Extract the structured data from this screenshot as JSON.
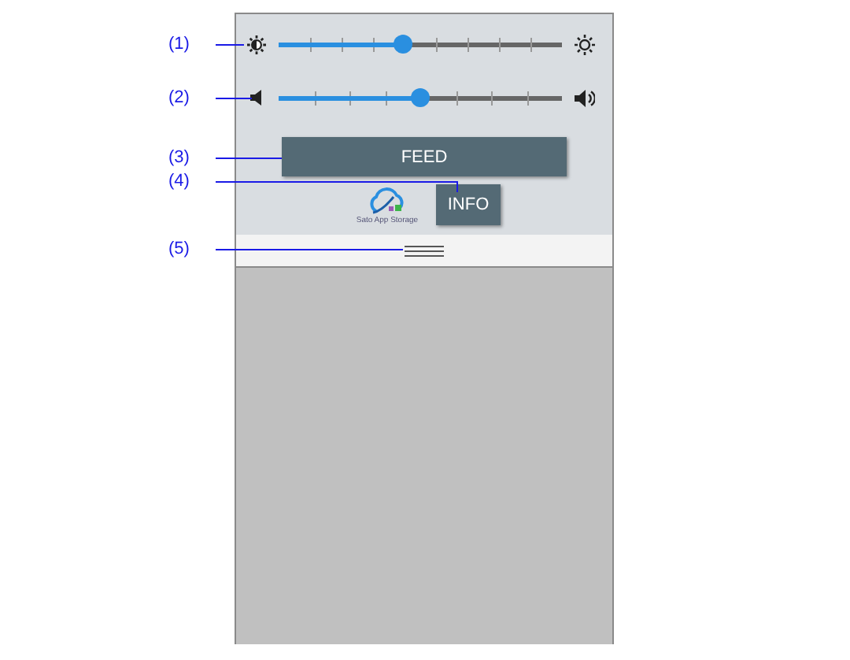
{
  "sliders": [
    {
      "kind": "brightness",
      "level": 0.44
    },
    {
      "kind": "volume",
      "level": 0.5
    }
  ],
  "feed_button": "FEED",
  "logo": {
    "text": "Sato App Storage"
  },
  "info_button": "INFO",
  "callouts": [
    {
      "label": "(1)"
    },
    {
      "label": "(2)"
    },
    {
      "label": "(3)"
    },
    {
      "label": "(4)"
    },
    {
      "label": "(5)"
    }
  ]
}
